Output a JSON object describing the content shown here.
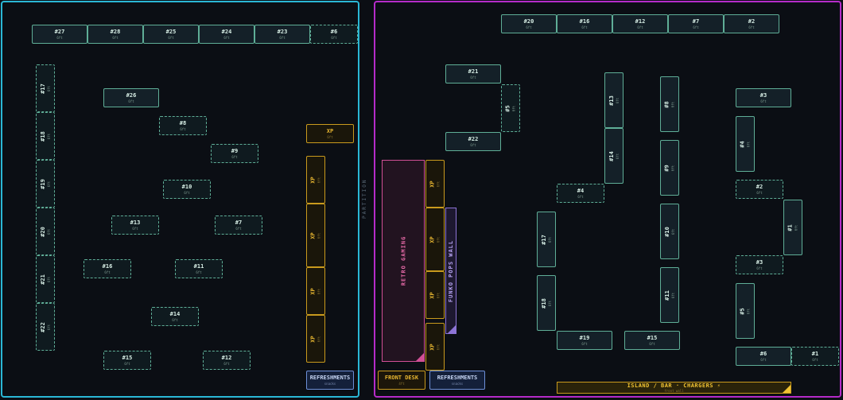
{
  "partition_label": "PARTITION",
  "sub_label": "6ft",
  "xp_label": "XP",
  "zones": {
    "retro_gaming": "RETRO GAMING",
    "funko_pops_wall": "FUNKO POPS WALL"
  },
  "island": {
    "label": "ISLAND / BAR · CHARGERS ⚡",
    "sub": "front wall"
  },
  "refreshments": {
    "label": "REFRESHMENTS",
    "sub": "snacks"
  },
  "front_desk": {
    "label": "FRONT DESK",
    "sub": "4ft"
  },
  "colors": {
    "left_room": "#2ab7d6",
    "right_room": "#b52bc9",
    "xp": "#c99a1d",
    "table": "#5fae97"
  },
  "left_tables": {
    "t27": "#27",
    "t28": "#28",
    "t25": "#25",
    "t24": "#24",
    "t23": "#23",
    "t6": "#6",
    "t17": "#17",
    "t18": "#18",
    "t19": "#19",
    "t20": "#20",
    "t21": "#21",
    "t22": "#22",
    "t26": "#26",
    "t8": "#8",
    "t9": "#9",
    "t10": "#10",
    "t13": "#13",
    "t7": "#7",
    "t16": "#16",
    "t11": "#11",
    "t14": "#14",
    "t15": "#15",
    "t12": "#12"
  },
  "right_tables": {
    "t20": "#20",
    "t16": "#16",
    "t12": "#12",
    "t7": "#7",
    "t2": "#2",
    "t21": "#21",
    "t5v": "#5",
    "t22": "#22",
    "t13": "#13",
    "t14": "#14",
    "t8": "#8",
    "t9": "#9",
    "t3": "#3",
    "t4v": "#4",
    "t2b": "#2",
    "t1v": "#1",
    "t3b": "#3",
    "t5b": "#5",
    "t6": "#6",
    "t1": "#1",
    "t4": "#4",
    "t17": "#17",
    "t18": "#18",
    "t10": "#10",
    "t11": "#11",
    "t19": "#19",
    "t15": "#15"
  }
}
